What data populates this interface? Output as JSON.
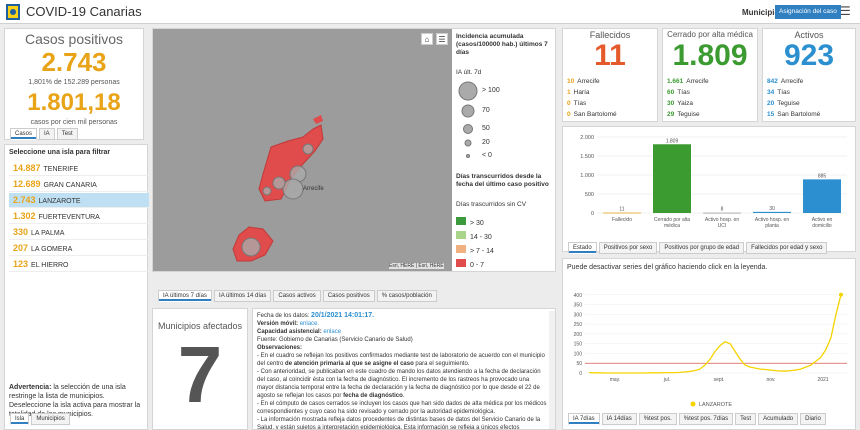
{
  "header": {
    "title": "COVID-19 Canarias",
    "municipio_label": "Municipio",
    "asignacion_button": "Asignación del caso",
    "menu_icon": "hamburger-menu-icon"
  },
  "casos": {
    "title": "Casos positivos",
    "value": "2.743",
    "pct_text": "1,801% de 152.289 personas",
    "rate": "1.801,18",
    "rate_text": "casos por cien mil personas",
    "tabs": [
      "Casos",
      "IA",
      "Test"
    ]
  },
  "islands": {
    "title": "Seleccione una isla para filtrar",
    "items": [
      {
        "num": "14.887",
        "name": "TENERIFE"
      },
      {
        "num": "12.689",
        "name": "GRAN CANARIA"
      },
      {
        "num": "2.743",
        "name": "LANZAROTE"
      },
      {
        "num": "1.302",
        "name": "FUERTEVENTURA"
      },
      {
        "num": "330",
        "name": "LA PALMA"
      },
      {
        "num": "207",
        "name": "LA GOMERA"
      },
      {
        "num": "123",
        "name": "EL HIERRO"
      }
    ],
    "selected_index": 2,
    "advertencia_bold": "Advertencia:",
    "advertencia_text": " la selección de una isla restringe la lista de municipios. Deseleccione la isla activa para mostrar la totalidad de los municipios.",
    "tabs": [
      "Isla",
      "Municipios"
    ]
  },
  "map": {
    "legend_title": "Incidencia acumulada (casos/100000 hab.) últimos 7 días",
    "ia_label": "IA últ. 7d",
    "sizes": [
      "> 100",
      "70",
      "50",
      "20",
      "< 0"
    ],
    "dias_title": "Días transcurridos desde la fecha del último caso positivo",
    "dias_sub": "Días trascurridos sin CV",
    "dias_items": [
      {
        "label": "> 30",
        "color": "#3a9a3c"
      },
      {
        "label": "14 - 30",
        "color": "#a8d58a"
      },
      {
        "label": "> 7 - 14",
        "color": "#f1b080"
      },
      {
        "label": "0 - 7",
        "color": "#e04b4b"
      }
    ],
    "place_label": "Arrecife",
    "attribution": "Esri, HERE | Esri, HERE",
    "tabs": [
      "IA últimos 7 días",
      "IA últimos 14 días",
      "Casos activos",
      "Casos positivos",
      "% casos/población"
    ]
  },
  "municipios": {
    "title": "Municipios afectados",
    "value": "7"
  },
  "info": {
    "fecha_label": "Fecha de los datos:",
    "fecha_value": "20/1/2021 14:01:17.",
    "version_label": "Versión móvil:",
    "version_link": "enlace.",
    "capacidad_label": "Capacidad asistencial:",
    "capacidad_link": "enlace",
    "fuente": "Fuente: Gobierno de Canarias (Servicio Canario de Salud)",
    "obs_label": "Observaciones:",
    "p1a": " - En el cuadro se reflejan los positivos confirmados mediante test de laboratorio de acuerdo con el municipio del centro ",
    "p1b": "de atención primaria al que se asigne el caso",
    "p1c": " para el seguimiento.",
    "p2a": " - Con anterioridad, se publicaban en este cuadro de mando los datos atendiendo a la fecha de declaración del caso, al coincidir ésta con la fecha de diagnóstico. El incremento de los rastreos ha provocado una mayor distancia temporal entre la fecha de declaración y la fecha de diagnóstico por lo que desde el 22 de agosto se reflejan los casos por ",
    "p2b": "fecha de diagnóstico",
    "p2c": ".",
    "p3": " - En el cómputo de casos cerrados se incluyen los casos que han sido dados de alta médica por los médicos correspondientes y cuyo caso ha sido revisado y cerrado por la autoridad epidemiológica.",
    "p4": " - La información mostrada refleja datos procedentes de distintas bases de datos del Servicio Canario de la Salud, y están sujetos a interpretación epidemiológica. Esta información se refleja a únicos efectos informativos y de transparencia. Los"
  },
  "fallecidos": {
    "title": "Fallecidos",
    "value": "11",
    "rows": [
      {
        "num": "10",
        "name": "Arrecife"
      },
      {
        "num": "1",
        "name": "Haría"
      },
      {
        "num": "0",
        "name": "Tías"
      },
      {
        "num": "0",
        "name": "San Bartolomé"
      }
    ]
  },
  "cerrado": {
    "title": "Cerrado por alta médica",
    "value": "1.809",
    "rows": [
      {
        "num": "1.661",
        "name": "Arrecife"
      },
      {
        "num": "60",
        "name": "Tías"
      },
      {
        "num": "30",
        "name": "Yaiza"
      },
      {
        "num": "29",
        "name": "Teguise"
      }
    ]
  },
  "activos": {
    "title": "Activos",
    "value": "923",
    "rows": [
      {
        "num": "842",
        "name": "Arrecife"
      },
      {
        "num": "34",
        "name": "Tías"
      },
      {
        "num": "20",
        "name": "Teguise"
      },
      {
        "num": "15",
        "name": "San Bartolomé"
      }
    ]
  },
  "bar_tabs": [
    "Estado",
    "Positivos por sexo",
    "Positivos por grupo de edad",
    "Fallecidos por edad y sexo"
  ],
  "line_note": "Puede desactivar series del gráfico haciendo click en la leyenda.",
  "line_tabs": [
    "IA 7días",
    "IA 14días",
    "%test pos.",
    "%test pos. 7días",
    "Test",
    "Acumulado",
    "Diario"
  ],
  "chart_data": [
    {
      "type": "bar",
      "categories": [
        "Fallecido",
        "Cerrado por alta médica",
        "Activo hosp. en UCI",
        "Activo hosp. en planta",
        "Activo en domicilio"
      ],
      "values": [
        11,
        1809,
        8,
        30,
        885
      ],
      "colors": [
        "#e8a317",
        "#3b9b30",
        "#9e9e9e",
        "#2b8fd0",
        "#2b8fd0"
      ],
      "ylim": [
        0,
        2000
      ],
      "yticks": [
        "0",
        "500",
        "1.000",
        "1.500",
        "2.000"
      ],
      "value_labels": [
        "11",
        "1.809",
        "8",
        "30",
        "885"
      ]
    },
    {
      "type": "line",
      "x_ticks": [
        "may.",
        "jul.",
        "sept.",
        "nov.",
        "2021"
      ],
      "yticks": [
        "0",
        "50",
        "100",
        "150",
        "200",
        "250",
        "300",
        "350",
        "400"
      ],
      "ylim": [
        0,
        450
      ],
      "series": [
        {
          "name": "LANZAROTE",
          "color": "#f5d400",
          "values": [
            2,
            1,
            1,
            0,
            0,
            0,
            0,
            0,
            0,
            0,
            0,
            0,
            1,
            1,
            1,
            2,
            2,
            2,
            3,
            5,
            8,
            12,
            20,
            40,
            70,
            110,
            140,
            160,
            150,
            110,
            70,
            40,
            30,
            25,
            20,
            18,
            15,
            12,
            10,
            10,
            12,
            15,
            20,
            30,
            40,
            60,
            80,
            120,
            180,
            300,
            400
          ]
        }
      ],
      "threshold": 50,
      "threshold_color": "#d9534f"
    }
  ]
}
